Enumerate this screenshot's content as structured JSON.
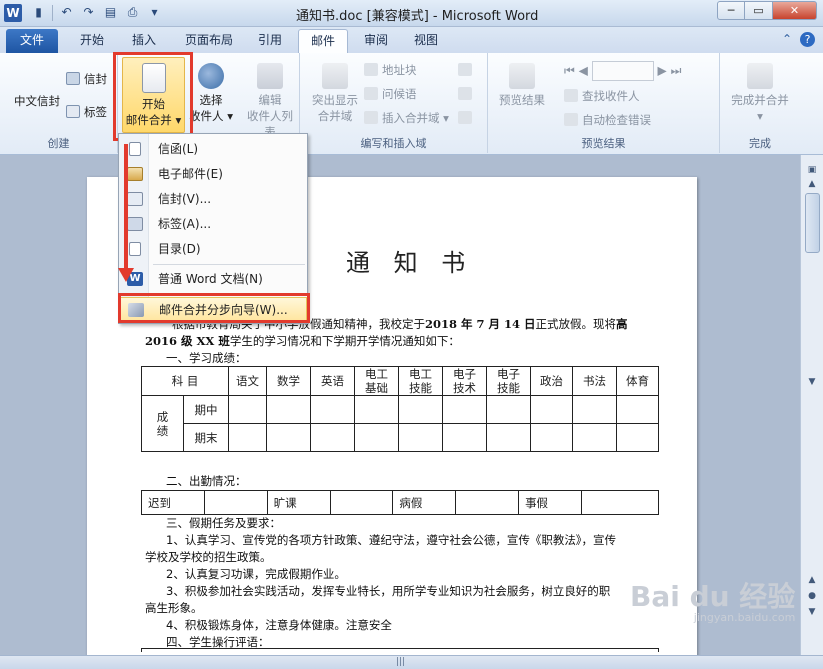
{
  "window": {
    "title": "通知书.doc [兼容模式] - Microsoft Word",
    "app_icon": "W"
  },
  "tabs": {
    "file": "文件",
    "items": [
      "开始",
      "插入",
      "页面布局",
      "引用",
      "邮件",
      "审阅",
      "视图"
    ],
    "active": "邮件"
  },
  "ribbon": {
    "create": {
      "label": "创建",
      "chinese_envelope": "中文信封",
      "envelope": "信封",
      "label_btn": "标签"
    },
    "start_merge": {
      "line1": "开始",
      "line2": "邮件合并"
    },
    "select_recipients": {
      "line1": "选择",
      "line2": "收件人"
    },
    "edit_recipients": {
      "line1": "编辑",
      "line2": "收件人列表"
    },
    "write_insert": {
      "label": "编写和插入域",
      "highlight_line1": "突出显示",
      "highlight_line2": "合并域",
      "address_block": "地址块",
      "greeting_line": "问候语",
      "insert_field": "插入合并域"
    },
    "preview": {
      "label": "预览结果",
      "preview_results": "预览结果",
      "find_recipient": "查找收件人",
      "auto_check": "自动检查错误"
    },
    "finish": {
      "label": "完成",
      "finish_merge": "完成并合并"
    }
  },
  "menu": {
    "items": [
      "信函(L)",
      "电子邮件(E)",
      "信封(V)...",
      "标签(A)...",
      "目录(D)",
      "普通 Word 文档(N)",
      "邮件合并分步向导(W)..."
    ]
  },
  "document": {
    "title": "通 知 书",
    "intro_1": "根据市教育局关于中小学放假通知精神，我校定于",
    "intro_date": "2018 年 7 月 14 日",
    "intro_2": "正式放假。现将",
    "intro_3a": "高",
    "intro_3b": "2016 级 XX 班",
    "intro_3c": "学生的学习情况和下学期开学情况通知如下：",
    "sec1": "一、学习成绩：",
    "score_headers": [
      "科 目",
      "语文",
      "数学",
      "英语",
      "电工\n基础",
      "电工\n技能",
      "电子\n技术",
      "电子\n技能",
      "政治",
      "书法",
      "体育"
    ],
    "score_row_group": "成\n绩",
    "score_rows": [
      "期中",
      "期末"
    ],
    "sec2": "二、出勤情况：",
    "attendance": [
      "迟到",
      "旷课",
      "病假",
      "事假"
    ],
    "sec3": "三、假期任务及要求：",
    "task1": "1、认真学习、宣传党的各项方针政策、遵纪守法，遵守社会公德，宣传《职教法》，宣传",
    "task1b": "学校及学校的招生政策。",
    "task2": "2、认真复习功课，完成假期作业。",
    "task3": "3、积极参加社会实践活动，发挥专业特长，用所学专业知识为社会服务，树立良好的职",
    "task3b": "高生形象。",
    "task4": "4、积极锻炼身体，注意身体健康。注意安全",
    "sec4": "四、学生操行评语：",
    "paragraph_mark": "↵"
  },
  "watermark": {
    "brand": "Bai du 经验",
    "url": "jingyan.baidu.com"
  },
  "colors": {
    "accent": "#2c5ca8",
    "highlight_box": "#e23a2d",
    "start_button": "#ffd86a"
  }
}
